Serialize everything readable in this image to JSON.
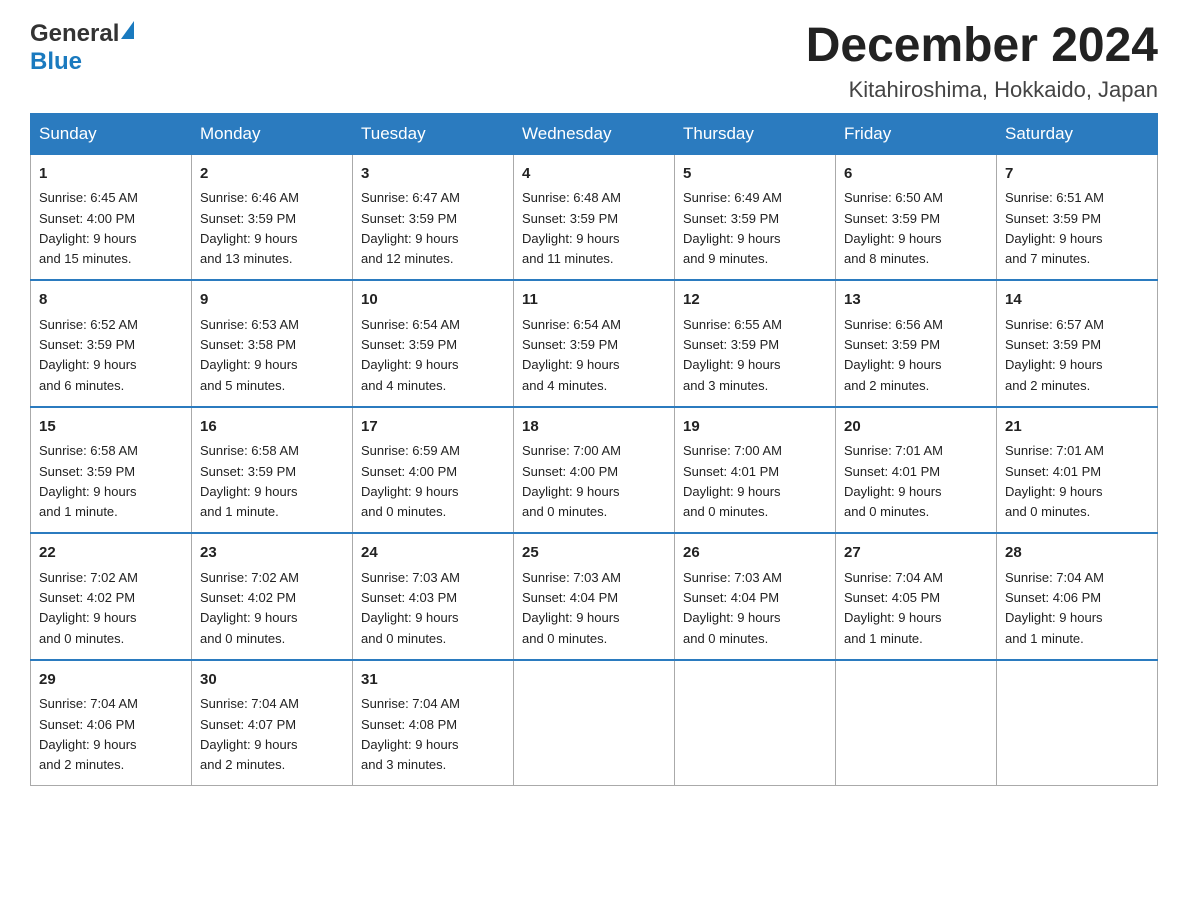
{
  "header": {
    "logo_general": "General",
    "logo_blue": "Blue",
    "month_title": "December 2024",
    "location": "Kitahiroshima, Hokkaido, Japan"
  },
  "weekdays": [
    "Sunday",
    "Monday",
    "Tuesday",
    "Wednesday",
    "Thursday",
    "Friday",
    "Saturday"
  ],
  "weeks": [
    [
      {
        "day": "1",
        "sunrise": "6:45 AM",
        "sunset": "4:00 PM",
        "daylight": "9 hours and 15 minutes."
      },
      {
        "day": "2",
        "sunrise": "6:46 AM",
        "sunset": "3:59 PM",
        "daylight": "9 hours and 13 minutes."
      },
      {
        "day": "3",
        "sunrise": "6:47 AM",
        "sunset": "3:59 PM",
        "daylight": "9 hours and 12 minutes."
      },
      {
        "day": "4",
        "sunrise": "6:48 AM",
        "sunset": "3:59 PM",
        "daylight": "9 hours and 11 minutes."
      },
      {
        "day": "5",
        "sunrise": "6:49 AM",
        "sunset": "3:59 PM",
        "daylight": "9 hours and 9 minutes."
      },
      {
        "day": "6",
        "sunrise": "6:50 AM",
        "sunset": "3:59 PM",
        "daylight": "9 hours and 8 minutes."
      },
      {
        "day": "7",
        "sunrise": "6:51 AM",
        "sunset": "3:59 PM",
        "daylight": "9 hours and 7 minutes."
      }
    ],
    [
      {
        "day": "8",
        "sunrise": "6:52 AM",
        "sunset": "3:59 PM",
        "daylight": "9 hours and 6 minutes."
      },
      {
        "day": "9",
        "sunrise": "6:53 AM",
        "sunset": "3:58 PM",
        "daylight": "9 hours and 5 minutes."
      },
      {
        "day": "10",
        "sunrise": "6:54 AM",
        "sunset": "3:59 PM",
        "daylight": "9 hours and 4 minutes."
      },
      {
        "day": "11",
        "sunrise": "6:54 AM",
        "sunset": "3:59 PM",
        "daylight": "9 hours and 4 minutes."
      },
      {
        "day": "12",
        "sunrise": "6:55 AM",
        "sunset": "3:59 PM",
        "daylight": "9 hours and 3 minutes."
      },
      {
        "day": "13",
        "sunrise": "6:56 AM",
        "sunset": "3:59 PM",
        "daylight": "9 hours and 2 minutes."
      },
      {
        "day": "14",
        "sunrise": "6:57 AM",
        "sunset": "3:59 PM",
        "daylight": "9 hours and 2 minutes."
      }
    ],
    [
      {
        "day": "15",
        "sunrise": "6:58 AM",
        "sunset": "3:59 PM",
        "daylight": "9 hours and 1 minute."
      },
      {
        "day": "16",
        "sunrise": "6:58 AM",
        "sunset": "3:59 PM",
        "daylight": "9 hours and 1 minute."
      },
      {
        "day": "17",
        "sunrise": "6:59 AM",
        "sunset": "4:00 PM",
        "daylight": "9 hours and 0 minutes."
      },
      {
        "day": "18",
        "sunrise": "7:00 AM",
        "sunset": "4:00 PM",
        "daylight": "9 hours and 0 minutes."
      },
      {
        "day": "19",
        "sunrise": "7:00 AM",
        "sunset": "4:01 PM",
        "daylight": "9 hours and 0 minutes."
      },
      {
        "day": "20",
        "sunrise": "7:01 AM",
        "sunset": "4:01 PM",
        "daylight": "9 hours and 0 minutes."
      },
      {
        "day": "21",
        "sunrise": "7:01 AM",
        "sunset": "4:01 PM",
        "daylight": "9 hours and 0 minutes."
      }
    ],
    [
      {
        "day": "22",
        "sunrise": "7:02 AM",
        "sunset": "4:02 PM",
        "daylight": "9 hours and 0 minutes."
      },
      {
        "day": "23",
        "sunrise": "7:02 AM",
        "sunset": "4:02 PM",
        "daylight": "9 hours and 0 minutes."
      },
      {
        "day": "24",
        "sunrise": "7:03 AM",
        "sunset": "4:03 PM",
        "daylight": "9 hours and 0 minutes."
      },
      {
        "day": "25",
        "sunrise": "7:03 AM",
        "sunset": "4:04 PM",
        "daylight": "9 hours and 0 minutes."
      },
      {
        "day": "26",
        "sunrise": "7:03 AM",
        "sunset": "4:04 PM",
        "daylight": "9 hours and 0 minutes."
      },
      {
        "day": "27",
        "sunrise": "7:04 AM",
        "sunset": "4:05 PM",
        "daylight": "9 hours and 1 minute."
      },
      {
        "day": "28",
        "sunrise": "7:04 AM",
        "sunset": "4:06 PM",
        "daylight": "9 hours and 1 minute."
      }
    ],
    [
      {
        "day": "29",
        "sunrise": "7:04 AM",
        "sunset": "4:06 PM",
        "daylight": "9 hours and 2 minutes."
      },
      {
        "day": "30",
        "sunrise": "7:04 AM",
        "sunset": "4:07 PM",
        "daylight": "9 hours and 2 minutes."
      },
      {
        "day": "31",
        "sunrise": "7:04 AM",
        "sunset": "4:08 PM",
        "daylight": "9 hours and 3 minutes."
      },
      null,
      null,
      null,
      null
    ]
  ]
}
